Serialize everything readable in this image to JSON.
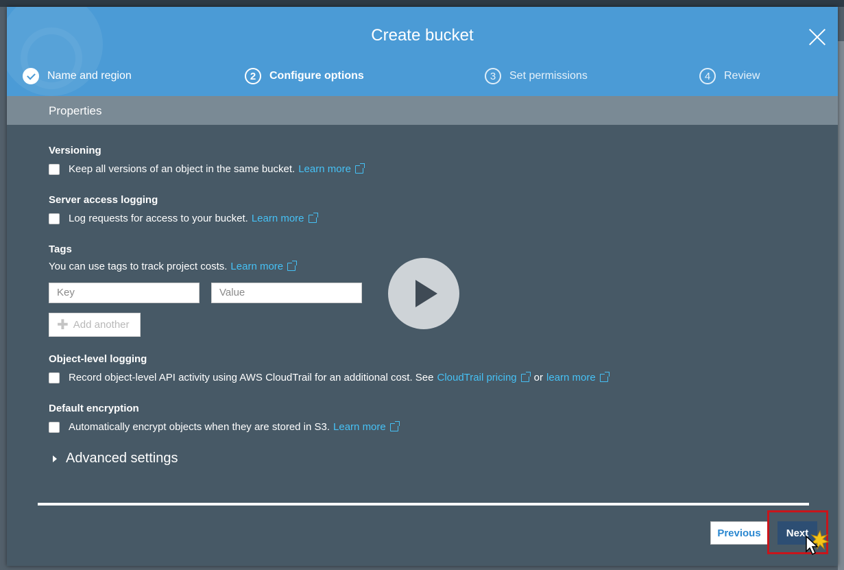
{
  "modal": {
    "title": "Create bucket"
  },
  "steps": [
    {
      "number": "1",
      "label": "Name and region",
      "state": "done"
    },
    {
      "number": "2",
      "label": "Configure options",
      "state": "active"
    },
    {
      "number": "3",
      "label": "Set permissions",
      "state": "inactive"
    },
    {
      "number": "4",
      "label": "Review",
      "state": "inactive"
    }
  ],
  "properties": {
    "header": "Properties",
    "versioning": {
      "title": "Versioning",
      "text": "Keep all versions of an object in the same bucket.",
      "link": "Learn more",
      "checked": false
    },
    "server_access_logging": {
      "title": "Server access logging",
      "text": "Log requests for access to your bucket.",
      "link": "Learn more",
      "checked": false
    },
    "tags": {
      "title": "Tags",
      "text": "You can use tags to track project costs.",
      "link": "Learn more",
      "key_placeholder": "Key",
      "value_placeholder": "Value",
      "add_another": "Add another"
    },
    "object_level_logging": {
      "title": "Object-level logging",
      "text": "Record object-level API activity using AWS CloudTrail for an additional cost. See",
      "link1": "CloudTrail pricing",
      "or": "or",
      "link2": "learn more",
      "checked": false
    },
    "default_encryption": {
      "title": "Default encryption",
      "text": "Automatically encrypt objects when they are stored in S3.",
      "link": "Learn more",
      "checked": false
    },
    "advanced_settings": "Advanced settings"
  },
  "footer": {
    "previous": "Previous",
    "next": "Next"
  },
  "colors": {
    "header": "#4b9bd6",
    "body": "#475966",
    "link": "#46c1f5",
    "highlight": "#c8151b"
  }
}
